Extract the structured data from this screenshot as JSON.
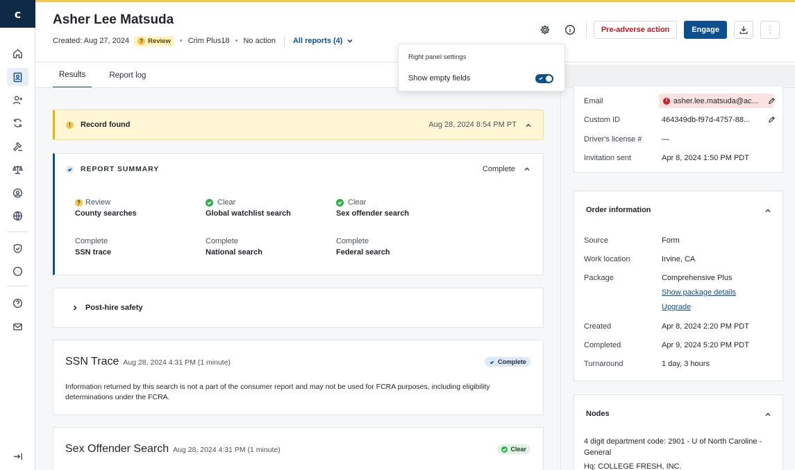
{
  "logo": "c",
  "header": {
    "candidate_name": "Asher Lee Matsuda",
    "created": "Created: Aug 27, 2024",
    "review_badge": "Review",
    "package": "Crim Plus18",
    "action": "No action",
    "all_reports": "All reports (4)",
    "pre_adverse_label": "Pre-adverse action",
    "engage_label": "Engage"
  },
  "tabs": [
    "Results",
    "Report log"
  ],
  "popover": {
    "title": "Right panel settings",
    "toggle_label": "Show empty fields",
    "toggle_on": true
  },
  "alert": {
    "label": "Record found",
    "time": "Aug 28, 2024 8:54 PM PT"
  },
  "summary": {
    "title": "REPORT SUMMARY",
    "status": "Complete",
    "items": [
      {
        "status": "Review",
        "name": "County searches"
      },
      {
        "status": "Clear",
        "name": "Global watchlist search"
      },
      {
        "status": "Clear",
        "name": "Sex offender search"
      },
      {
        "status": "Complete",
        "name": "SSN trace"
      },
      {
        "status": "Complete",
        "name": "National search"
      },
      {
        "status": "Complete",
        "name": "Federal search"
      }
    ]
  },
  "post_hire": "Post-hire safety",
  "ssn_card": {
    "title": "SSN Trace",
    "time": "Aug 28, 2024 4:31 PM (1 minute)",
    "status": "Complete",
    "body": "Information returned by this search is not a part of the consumer report and may not be used for FCRA purposes, including eligibility determinations under the FCRA."
  },
  "sex_card": {
    "title": "Sex Offender Search",
    "time": "Aug 28, 2024 4:31 PM (1 minute)",
    "status": "Clear"
  },
  "candidate_info": {
    "email_label": "Email",
    "email_value": "asher.lee.matsuda@ac...",
    "custom_id_label": "Custom ID",
    "custom_id_value": "464349db-f97d-4757-88...",
    "license_label": "Driver's license #",
    "license_value": "—",
    "invitation_label": "Invitation sent",
    "invitation_value": "Apr 8, 2024 1:50 PM PDT"
  },
  "order_info": {
    "title": "Order information",
    "source_label": "Source",
    "source_value": "Form",
    "work_label": "Work location",
    "work_value": "Irvine, CA",
    "package_label": "Package",
    "package_value": "Comprehensive Plus",
    "show_package_link": "Show package details",
    "upgrade_link": "Upgrade",
    "created_label": "Created",
    "created_value": "Apr 8, 2024 2:20 PM PDT",
    "completed_label": "Completed",
    "completed_value": "Apr 9, 2024 5:20 PM PDT",
    "turnaround_label": "Turnaround",
    "turnaround_value": "1 day, 3 hours"
  },
  "nodes": {
    "title": "Nodes",
    "line1": "4 digit department code: 2901 - U of North Caroline -",
    "line2": "General",
    "line3": "Hq: COLLEGE FRESH, INC."
  },
  "colors": {
    "brand_navy": "#0e2a47",
    "primary": "#0b4f8f",
    "danger": "#c0171f",
    "review_yellow": "#f2c94c",
    "clear_green": "#2bb04a"
  }
}
